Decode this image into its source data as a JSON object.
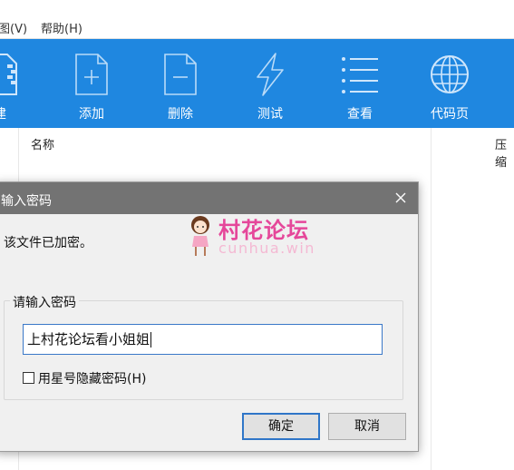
{
  "menu": {
    "items": [
      "图(V)",
      "帮助(H)"
    ]
  },
  "toolbar": {
    "buttons": [
      {
        "label": "建",
        "icon": "zip-file-icon"
      },
      {
        "label": "添加",
        "icon": "add-file-icon"
      },
      {
        "label": "删除",
        "icon": "delete-file-icon"
      },
      {
        "label": "测试",
        "icon": "lightning-icon"
      },
      {
        "label": "查看",
        "icon": "list-view-icon"
      },
      {
        "label": "代码页",
        "icon": "globe-icon"
      }
    ],
    "background": "#1f87e0"
  },
  "file_list": {
    "columns": [
      "名称",
      "压缩"
    ]
  },
  "dialog": {
    "title": "输入密码",
    "message": "该文件已加密。",
    "group_label": "请输入密码",
    "password_value": "上村花论坛看小姐姐",
    "hide_checkbox_label": "用星号隐藏密码(H)",
    "hide_checked": false,
    "ok_label": "确定",
    "cancel_label": "取消"
  },
  "watermark": {
    "text": "村花论坛",
    "url": "cunhua.win"
  }
}
